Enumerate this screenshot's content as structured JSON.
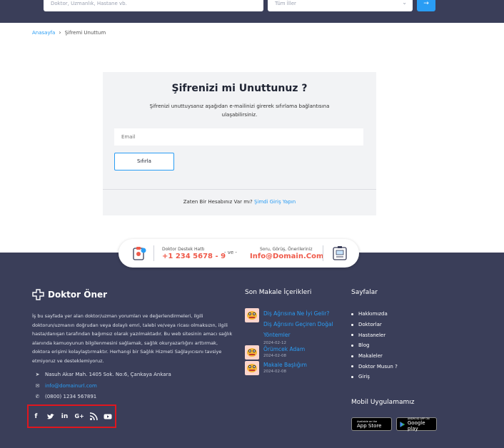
{
  "search": {
    "placeholder": "Doktor, Uzmanlık, Hastane vb.",
    "city_select": "Tüm İller",
    "submit_icon": "arrow-right-icon"
  },
  "breadcrumb": {
    "home": "Anasayfa",
    "current": "Şifremi Unuttum"
  },
  "reset": {
    "title": "Şifrenizi mi Unuttunuz ?",
    "description": "Şifrenizi unuttuysanız aşağıdan e-mailinizi girerek sıfırlama bağlantısına ulaşabilirsiniz.",
    "email_placeholder": "Email",
    "button": "Sıfırla",
    "footer_text": "Zaten Bir Hesabınız Var mı?",
    "footer_link": "Şimdi Giriş Yapın"
  },
  "support": {
    "hotline_label": "Doktor Destek Hattı",
    "hotline_value": "+1 234 5678 - 9",
    "separator": "- ve -",
    "mail_label": "Soru, Görüş, Önerileriniz",
    "mail_value": "Info@Domain.Com"
  },
  "footer": {
    "logo": "Doktor Öner",
    "about": "İş bu sayfada yer alan doktor/uzman yorumları ve değerlendirmeleri, ilgili doktorun/uzmanın doğrudan veya dolaylı emri, talebi ve/veya ricası olmaksızın, ilgili hasta/danışan tarafından bağımsız olarak yazılmaktadır. Bu web sitesinin amacı sağlık alanında kamuoyunun bilgilenmesini sağlamak, sağlık okuryazarlığını arttırmak, doktora erişimi kolaylaştırmaktır. Herhangi bir Sağlık Hizmeti Sağlayıcısını tavsiye etmiyoruz ve desteklemiyoruz.",
    "address": "Nasuh Akar Mah. 1405 Sok. No:6, Çankaya Ankara",
    "email": "info@domainurl.com",
    "phone": "(0800) 1234 567891",
    "social_icons": [
      "facebook-icon",
      "twitter-icon",
      "linkedin-icon",
      "google-plus-icon",
      "rss-icon",
      "youtube-icon"
    ],
    "articles_title": "Son Makale İçerikleri",
    "articles": [
      {
        "title": "Diş Ağrısına Ne İyi Gelir? Diş Ağrısını Geçiren Doğal Yöntemler",
        "date": "2024-02-12"
      },
      {
        "title": "Örümcek Adam",
        "date": "2024-02-08"
      },
      {
        "title": "Makale Başlığım",
        "date": "2024-02-08"
      }
    ],
    "pages_title": "Sayfalar",
    "pages": [
      "Hakkımızda",
      "Doktorlar",
      "Hastaneler",
      "Blog",
      "Makaleler",
      "Doktor Musun ?",
      "Giriş"
    ],
    "mobile_title": "Mobil Uygulamamız",
    "app_store_small": "Available on the",
    "app_store": "App Store",
    "google_play_small": "ANDROID APP ON",
    "google_play": "Google play"
  },
  "colors": {
    "accent": "#2a9df4",
    "footer_bg": "#3a3e59",
    "phone_red": "#ef5a4a",
    "highlight_border": "#e0161e"
  }
}
